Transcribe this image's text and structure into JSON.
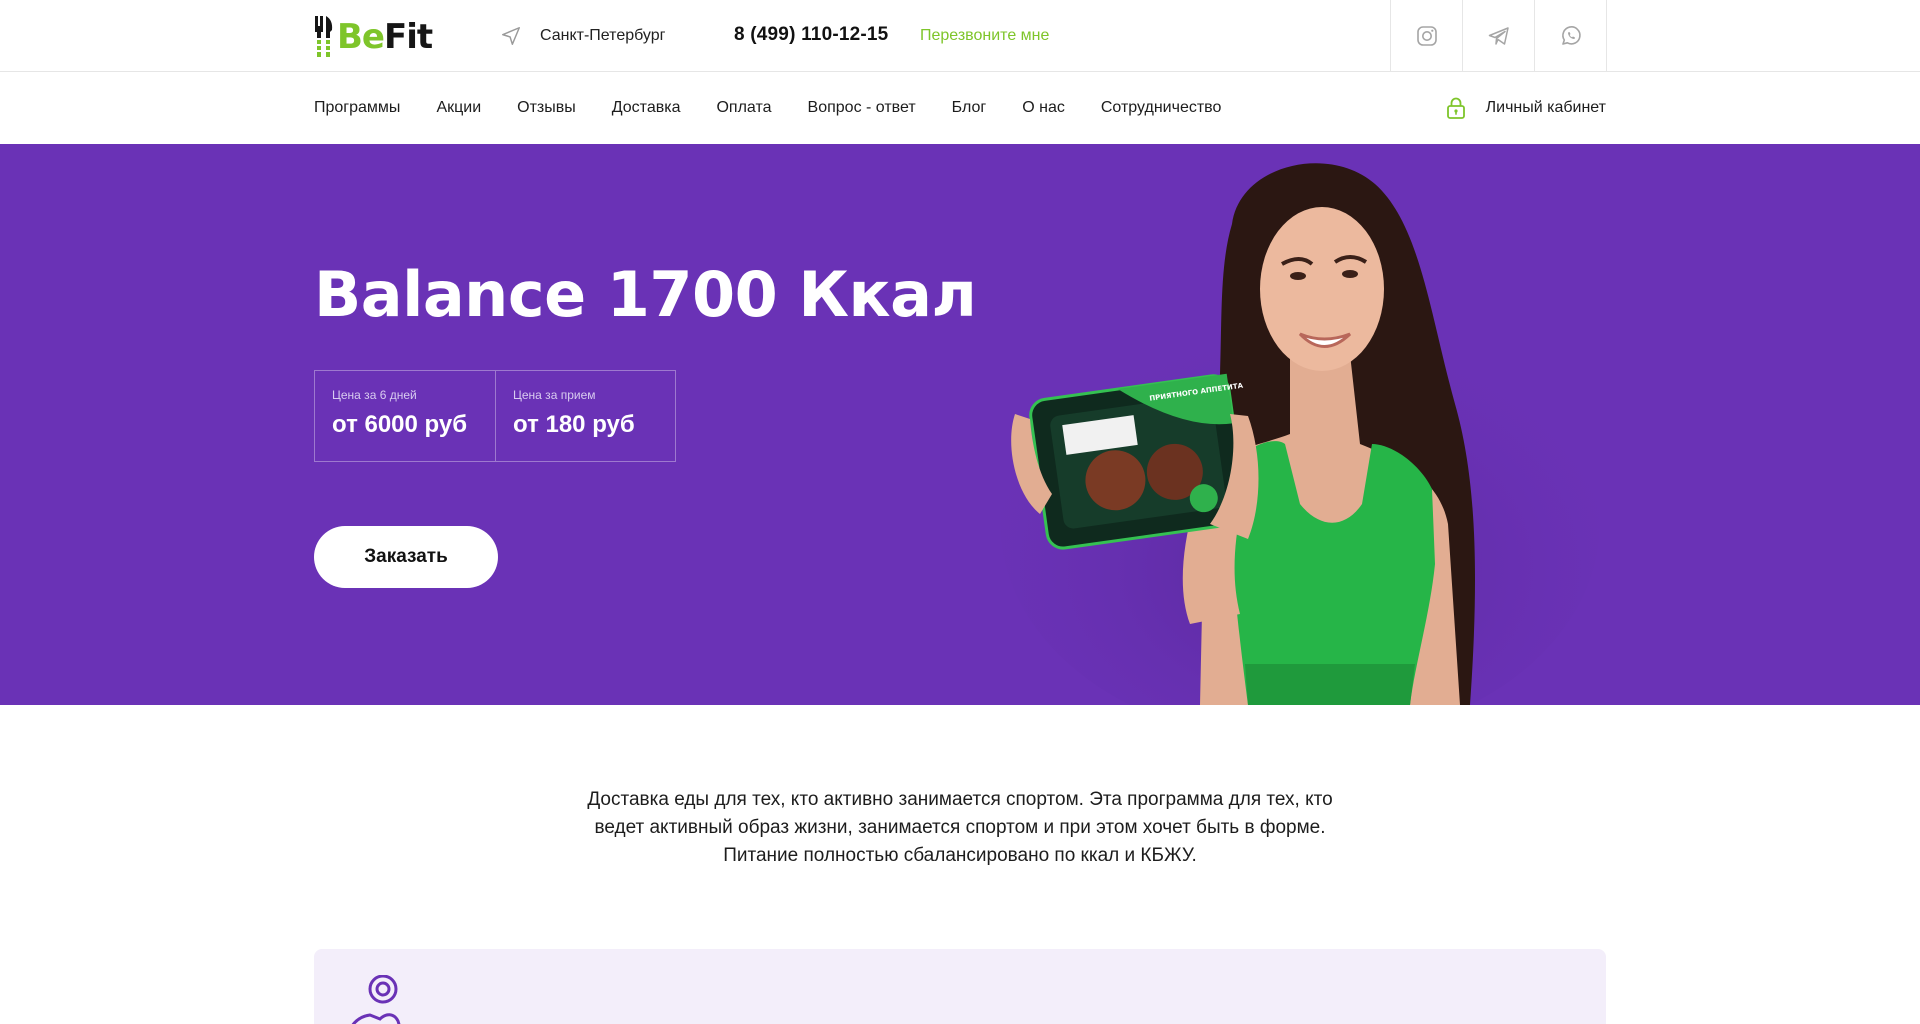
{
  "brand": {
    "logo_be": "Be",
    "logo_fit": "Fit",
    "accent_color": "#7ec52a",
    "hero_color": "#6a32b6"
  },
  "header": {
    "city": "Санкт-Петербург",
    "city_icon": "location-arrow-icon",
    "phone": "8 (499) 110-12-15",
    "callback": "Перезвоните мне",
    "socials": [
      "instagram-icon",
      "telegram-icon",
      "whatsapp-icon"
    ]
  },
  "nav": {
    "items": [
      "Программы",
      "Акции",
      "Отзывы",
      "Доставка",
      "Оплата",
      "Вопрос - ответ",
      "Блог",
      "О нас",
      "Сотрудничество"
    ],
    "account_label": "Личный кабинет",
    "account_icon": "lock-icon"
  },
  "hero": {
    "title": "Balance 1700 Ккал",
    "prices": [
      {
        "label": "Цена за 6 дней",
        "value": "от 6000 руб"
      },
      {
        "label": "Цена за прием",
        "value": "от 180 руб"
      }
    ],
    "order_button": "Заказать",
    "tray_label": "ПРИЯТНОГО АППЕТИТА"
  },
  "description": {
    "lines": [
      "Доставка еды для тех, кто активно занимается спортом. Эта программа для тех, кто",
      "ведет активный образ жизни, занимается спортом и при этом хочет быть в форме.",
      "Питание полностью сбалансировано по ккал и КБЖУ."
    ]
  }
}
